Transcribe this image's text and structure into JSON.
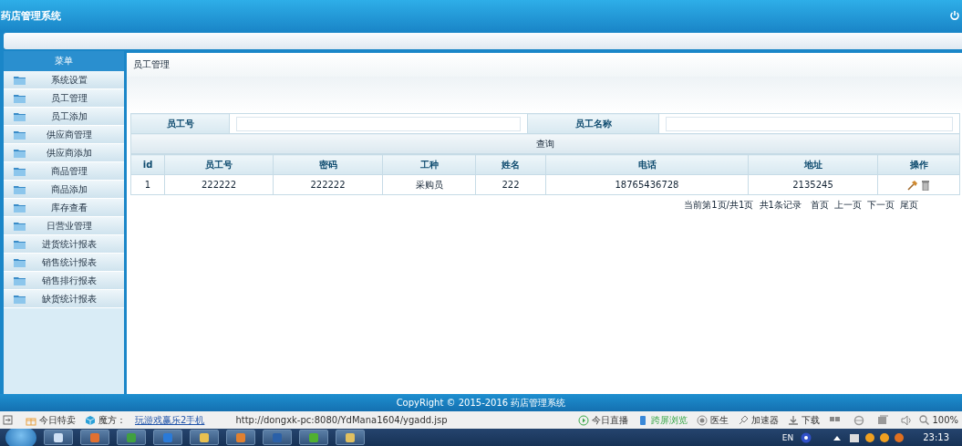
{
  "app": {
    "title": "药店管理系统"
  },
  "sidebar": {
    "title": "菜单",
    "items": [
      {
        "label": "系统设置"
      },
      {
        "label": "员工管理"
      },
      {
        "label": "员工添加"
      },
      {
        "label": "供应商管理"
      },
      {
        "label": "供应商添加"
      },
      {
        "label": "商品管理"
      },
      {
        "label": "商品添加"
      },
      {
        "label": "库存查看"
      },
      {
        "label": "日营业管理"
      },
      {
        "label": "进货统计报表"
      },
      {
        "label": "销售统计报表"
      },
      {
        "label": "销售排行报表"
      },
      {
        "label": "缺货统计报表"
      }
    ]
  },
  "page": {
    "title": "员工管理"
  },
  "search_form": {
    "fields": [
      {
        "label": "员工号"
      },
      {
        "label": "员工名称"
      }
    ],
    "button": "查询"
  },
  "table": {
    "columns": [
      "id",
      "员工号",
      "密码",
      "工种",
      "姓名",
      "电话",
      "地址",
      "操作"
    ],
    "rows": [
      {
        "cells": [
          "1",
          "222222",
          "222222",
          "采购员",
          "222",
          "18765436728",
          "2135245"
        ]
      }
    ]
  },
  "pagination": {
    "summary": "当前第1页/共1页  共1条记录",
    "links": [
      "首页",
      "上一页",
      "下一页",
      "尾页"
    ]
  },
  "footer": "CopyRight © 2015-2016 药店管理系统",
  "browser_status": {
    "items": [
      {
        "kind": "gift",
        "label": "今日特卖"
      },
      {
        "kind": "cube",
        "label": "魔方："
      }
    ],
    "link": "玩游戏赢乐2手机",
    "url": "http://dongxk-pc:8080/YdMana1604/ygadd.jsp",
    "tools": [
      {
        "kind": "play",
        "label": "今日直播"
      },
      {
        "kind": "phone",
        "label": "跨屏浏览"
      },
      {
        "kind": "doctor",
        "label": "医生"
      },
      {
        "kind": "rocket",
        "label": "加速器"
      },
      {
        "kind": "download",
        "label": "下载"
      }
    ],
    "zoom": "100%"
  },
  "taskbar": {
    "language": "EN",
    "clock": "23:13"
  }
}
